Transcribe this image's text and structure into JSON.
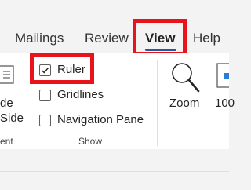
{
  "tabs": [
    {
      "label": "Mailings"
    },
    {
      "label": "Review"
    },
    {
      "label": "View"
    },
    {
      "label": "Help"
    }
  ],
  "left_group": {
    "button_label_line1": "de",
    "button_label_line2": "Side",
    "group_label": "ent"
  },
  "show_group": {
    "ruler_label": "Ruler",
    "gridlines_label": "Gridlines",
    "navigation_pane_label": "Navigation Pane",
    "group_label": "Show",
    "ruler_checked": true,
    "gridlines_checked": false,
    "navigation_pane_checked": false
  },
  "zoom_group": {
    "zoom_label": "Zoom",
    "hundred_label": "100"
  },
  "colors": {
    "highlight": "#e8141b",
    "accent": "#2b579a"
  }
}
